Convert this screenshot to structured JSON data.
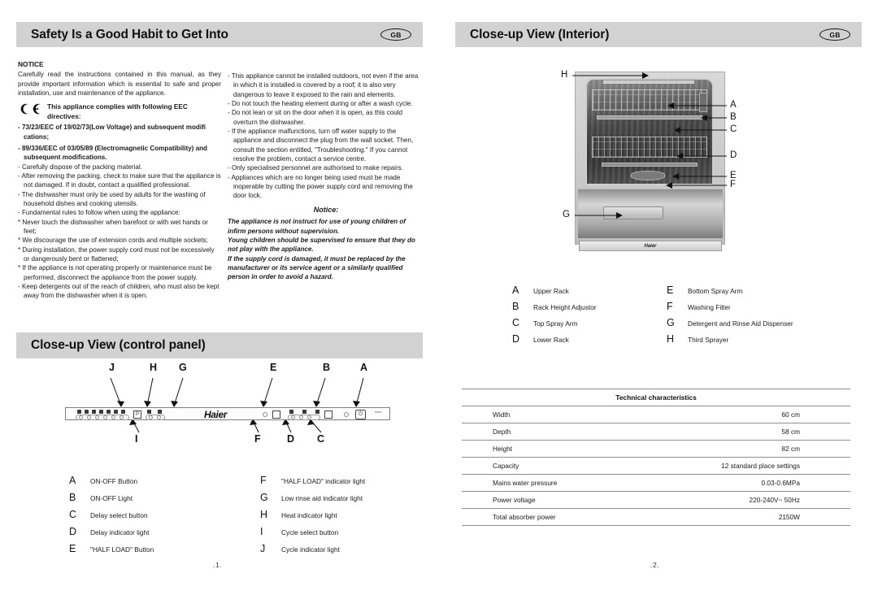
{
  "left_page": {
    "header": {
      "title": "Safety Is a Good Habit to Get Into",
      "region_badge": "GB"
    },
    "notice_heading": "NOTICE",
    "intro": "Carefully read the instructions contained in this manual, as they provide important information which is essential to safe and proper installation, use and maintenance of the appliance.",
    "ce": {
      "icon": "ce-mark",
      "text": "This appliance complies with following EEC directives:"
    },
    "directives": [
      "- 73/23/EEC of 19/02/73(Low Voltage) and subsequent modifi cations;",
      "- 89/336/EEC of 03/05/89 (Electromagnetic Compatibility) and subsequent modifications."
    ],
    "bullets_left": [
      "- Carefully dispose of the packing material.",
      "- After removing the packing, check to make sure that the appliance is not damaged. If  in doubt, contact a qualified professional.",
      "- The dishwasher must only be used by adults for the washing of household dishes and cooking utensils.",
      "- Fundamental rules to follow when using the appliance:",
      "* Never touch the dishwasher when barefoot or with wet hands or feet;",
      "* We discourage the use of extension cords and multiple sockets;",
      "* During installation, the power supply cord must not be excessively or dangerously bent or flattened;",
      "* If the appliance is not operating properly or maintenance must be performed, disconnect the appliance from the power supply.",
      "- Keep detergents out of the reach of children, who must also be kept away from the dishwasher when it is open."
    ],
    "bullets_right": [
      "- This appliance cannot be installed outdoors, not even if the area in which it is  installed is covered by a roof; it is also very dangerous to leave it exposed to the rain and elements.",
      "- Do not touch the heating element during or after a wash cycle.",
      "- Do not lean or sit on the door when it is open, as this could overturn the dishwasher.",
      "- If the appliance malfunctions, turn off water supply to the appliance and disconnect the plug from the wall socket. Then, consult the section entitled, \"Troubleshooting.\" If you cannot resolve the problem, contact a service centre.",
      "- Only specialised personnel are authorised to make repairs.",
      "- Appliances which are no longer being used must be made inoperable by cutting the power supply cord and removing the door lock."
    ],
    "notice2_heading": "Notice:",
    "notice2_paragraphs": [
      "The appliance is not instruct for use of young children of infirm persons without supervision.",
      "Young children should be supervised to ensure that they do not play with the appliance.",
      "If the supply cord is damaged, it must be replaced by the manufacturer or its service agent or a similarly qualified person in order to avoid a hazard."
    ],
    "control_panel": {
      "header_title": "Close-up View (control panel)",
      "brand": "Haier",
      "callouts_top": [
        "J",
        "H",
        "G",
        "E",
        "B",
        "A"
      ],
      "callouts_bottom": [
        "I",
        "F",
        "D",
        "C"
      ],
      "legend": [
        {
          "key": "A",
          "label": "ON-OFF Button"
        },
        {
          "key": "B",
          "label": "ON-OFF Light"
        },
        {
          "key": "C",
          "label": "Delay select button"
        },
        {
          "key": "D",
          "label": "Delay indicator light"
        },
        {
          "key": "E",
          "label": "\"HALF LOAD\" Button"
        },
        {
          "key": "F",
          "label": "\"HALF LOAD\" indicator light"
        },
        {
          "key": "G",
          "label": "Low rinse aid indicator light"
        },
        {
          "key": "H",
          "label": "Heat indicator light"
        },
        {
          "key": "I",
          "label": "Cycle select button"
        },
        {
          "key": "J",
          "label": "Cycle indicator light"
        }
      ]
    },
    "page_number": ".1."
  },
  "right_page": {
    "header": {
      "title": "Close-up View (Interior)",
      "region_badge": "GB"
    },
    "photo_callouts": [
      "H",
      "A",
      "B",
      "C",
      "D",
      "E",
      "F",
      "G"
    ],
    "photo_brand": "Haier",
    "legend": [
      {
        "key": "A",
        "label": "Upper Rack"
      },
      {
        "key": "B",
        "label": "Rack Height Adjustor"
      },
      {
        "key": "C",
        "label": "Top Spray Arm"
      },
      {
        "key": "D",
        "label": "Lower Rack"
      },
      {
        "key": "E",
        "label": "Bottom Spray Arm"
      },
      {
        "key": "F",
        "label": "Washing Filter"
      },
      {
        "key": "G",
        "label": "Detergent and Rinse Aid Dispenser"
      },
      {
        "key": "H",
        "label": "Third Sprayer"
      }
    ],
    "tech_table": {
      "caption": "Technical characteristics",
      "rows": [
        {
          "k": "Width",
          "v": "60 cm"
        },
        {
          "k": "Depth",
          "v": "58 cm"
        },
        {
          "k": "Height",
          "v": "82 cm"
        },
        {
          "k": "Capacity",
          "v": "12 standard place settings"
        },
        {
          "k": "Mains water pressure",
          "v": "0.03-0.6MPa"
        },
        {
          "k": "Power voltage",
          "v": "220-240V~  50Hz"
        },
        {
          "k": "Total absorber power",
          "v": "2150W"
        }
      ]
    },
    "page_number": ".2."
  },
  "colors": {
    "header_bar": "#d2d2d2",
    "text": "#1a1a1a",
    "rule": "#8e8e8e"
  }
}
